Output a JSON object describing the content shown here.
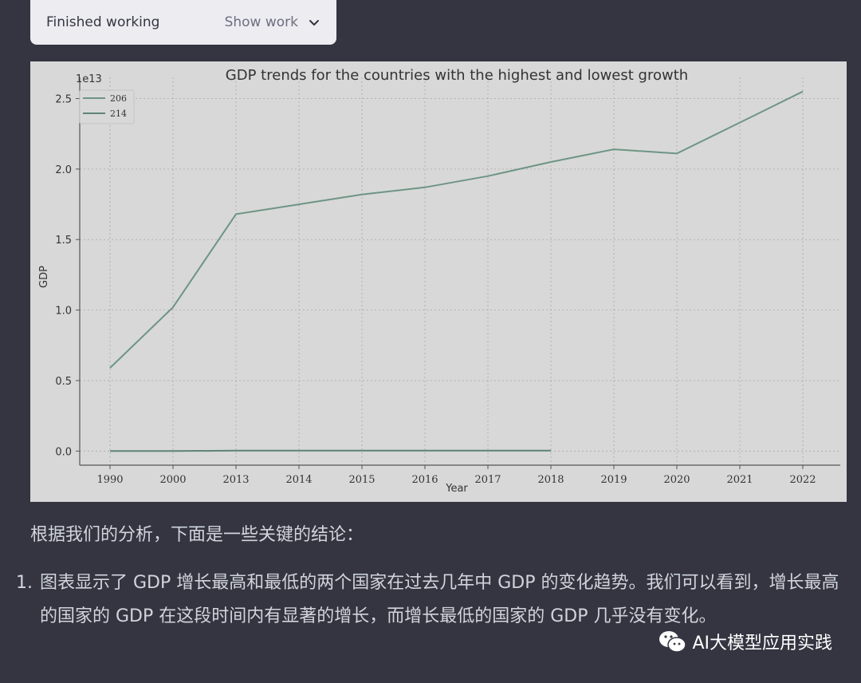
{
  "work_panel": {
    "status": "Finished working",
    "toggle_label": "Show work"
  },
  "chart_data": {
    "type": "line",
    "title": "GDP trends for the countries with the highest and lowest growth",
    "xlabel": "Year",
    "ylabel": "GDP",
    "y_scale_label": "1e13",
    "categories": [
      "1990",
      "2000",
      "2013",
      "2014",
      "2015",
      "2016",
      "2017",
      "2018",
      "2019",
      "2020",
      "2021",
      "2022"
    ],
    "ylim": [
      -0.1,
      2.65
    ],
    "yticks": [
      "0.0",
      "0.5",
      "1.0",
      "1.5",
      "2.0",
      "2.5"
    ],
    "ytick_values": [
      0.0,
      0.5,
      1.0,
      1.5,
      2.0,
      2.5
    ],
    "grid": true,
    "legend_position": "top-left",
    "series": [
      {
        "name": "206",
        "color": "#6e9584",
        "values": [
          0.59,
          1.02,
          1.68,
          1.75,
          1.82,
          1.87,
          1.95,
          2.05,
          2.14,
          2.11,
          2.33,
          2.55
        ]
      },
      {
        "name": "214",
        "color": "#5e8474",
        "values": [
          0.0,
          0.0,
          0.003,
          0.003,
          0.003,
          0.003,
          0.003,
          0.003,
          null,
          null,
          null,
          null
        ]
      }
    ]
  },
  "text": {
    "intro": "根据我们的分析，下面是一些关键的结论：",
    "items": [
      {
        "num": "1.",
        "text": "图表显示了 GDP 增长最高和最低的两个国家在过去几年中 GDP 的变化趋势。我们可以看到，增长最高的国家的 GDP 在这段时间内有显著的增长，而增长最低的国家的 GDP 几乎没有变化。"
      }
    ]
  },
  "watermark": {
    "label": "AI大模型应用实践",
    "icon": "wechat-icon"
  }
}
